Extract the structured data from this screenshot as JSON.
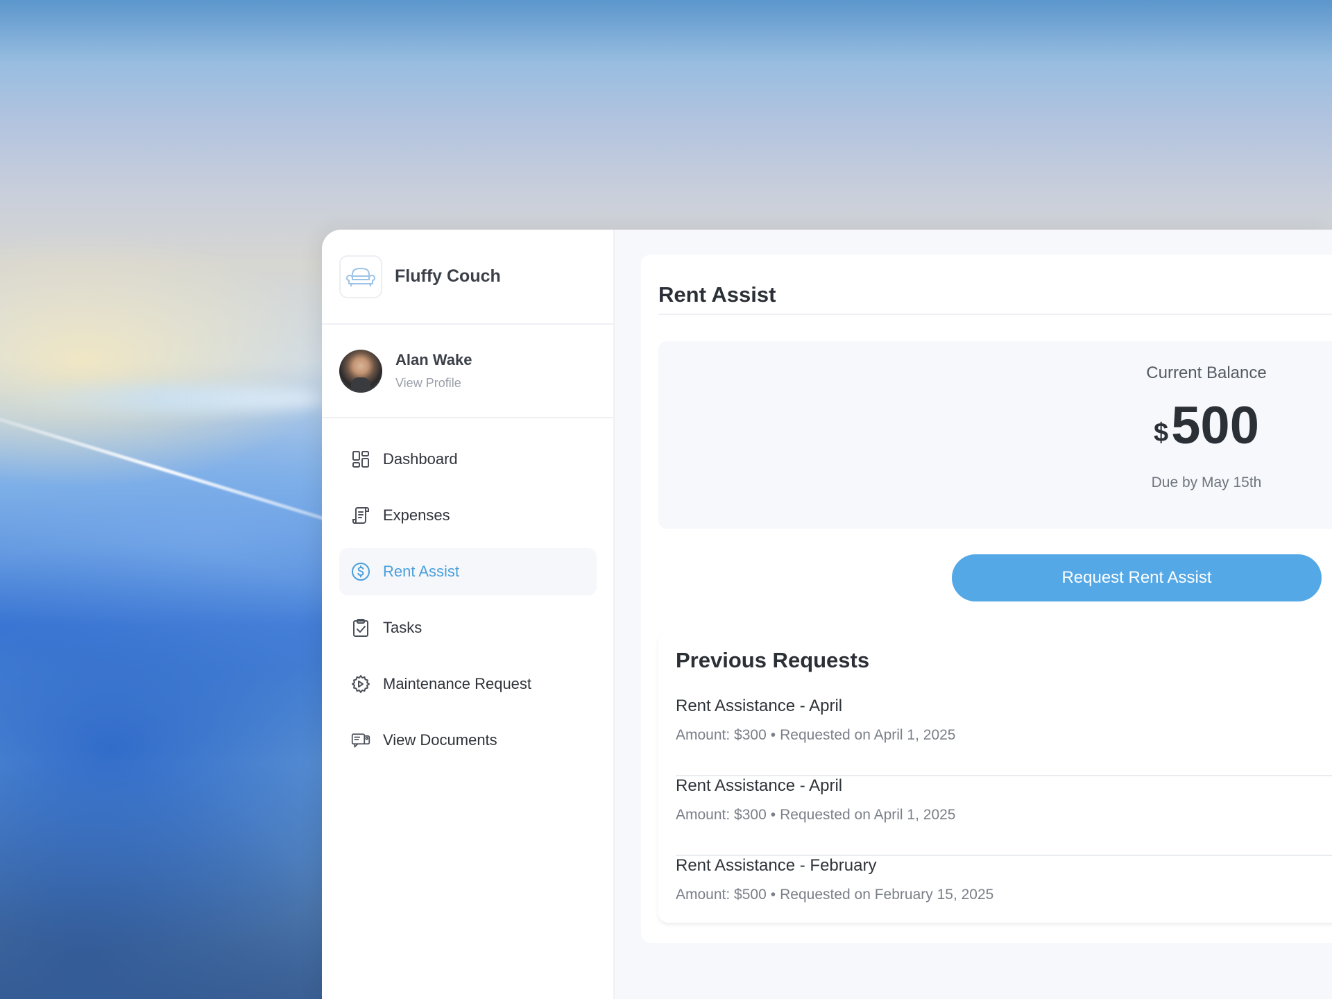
{
  "brand": {
    "name": "Fluffy Couch",
    "logo_icon": "couch-icon"
  },
  "profile": {
    "name": "Alan Wake",
    "link": "View Profile"
  },
  "nav": [
    {
      "label": "Dashboard",
      "icon": "dashboard-icon",
      "active": false
    },
    {
      "label": "Expenses",
      "icon": "receipt-icon",
      "active": false
    },
    {
      "label": "Rent Assist",
      "icon": "dollar-circle-icon",
      "active": true
    },
    {
      "label": "Tasks",
      "icon": "clipboard-check-icon",
      "active": false
    },
    {
      "label": "Maintenance Request",
      "icon": "gear-icon",
      "active": false
    },
    {
      "label": "View Documents",
      "icon": "documents-icon",
      "active": false
    }
  ],
  "main": {
    "title": "Rent Assist",
    "balance": {
      "label": "Current Balance",
      "currency": "$",
      "amount": "500",
      "due": "Due by May 15th"
    },
    "request_button": "Request Rent Assist",
    "previous": {
      "title": "Previous Requests",
      "items": [
        {
          "title": "Rent Assistance - April",
          "amount": "Amount: $300",
          "requested": "Requested on April 1, 2025"
        },
        {
          "title": "Rent Assistance - April",
          "amount": "Amount: $300",
          "requested": "Requested on April 1, 2025"
        },
        {
          "title": "Rent Assistance - February",
          "amount": "Amount: $500",
          "requested": "Requested on February 15, 2025"
        }
      ]
    }
  },
  "colors": {
    "accent": "#55a8e6",
    "active_text": "#4a9fdc",
    "card_bg": "#f6f8fc"
  }
}
